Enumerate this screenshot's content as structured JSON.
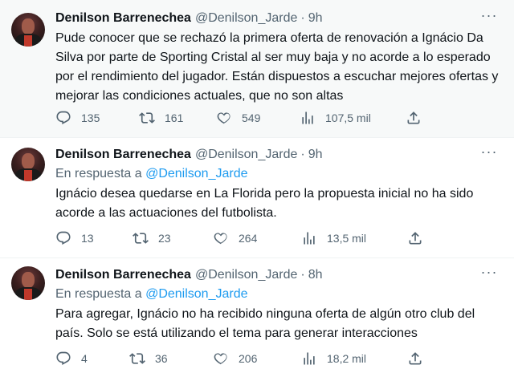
{
  "tweets": [
    {
      "name": "Denilson Barrenechea",
      "handle": "@Denilson_Jarde",
      "separator": "·",
      "time": "9h",
      "reply_prefix": "",
      "reply_handle": "",
      "text": "Pude conocer que se rechazó la primera oferta de renovación a Ignácio Da Silva por parte de Sporting Cristal al ser muy baja y no acorde a lo esperado por el rendimiento del jugador. Están dispuestos a escuchar mejores ofertas y mejorar las condiciones actuales, que no son  altas",
      "replies": "135",
      "retweets": "161",
      "likes": "549",
      "views": "107,5 mil"
    },
    {
      "name": "Denilson Barrenechea",
      "handle": "@Denilson_Jarde",
      "separator": "·",
      "time": "9h",
      "reply_prefix": "En respuesta a",
      "reply_handle": "@Denilson_Jarde",
      "text": "Ignácio desea quedarse en La Florida pero la propuesta inicial no ha sido acorde a las actuaciones del futbolista.",
      "replies": "13",
      "retweets": "23",
      "likes": "264",
      "views": "13,5 mil"
    },
    {
      "name": "Denilson Barrenechea",
      "handle": "@Denilson_Jarde",
      "separator": "·",
      "time": "8h",
      "reply_prefix": "En respuesta a",
      "reply_handle": "@Denilson_Jarde",
      "text": "Para agregar, Ignácio no ha recibido ninguna oferta de algún otro club del país. Solo se está utilizando el tema para generar interacciones",
      "replies": "4",
      "retweets": "36",
      "likes": "206",
      "views": "18,2 mil"
    }
  ],
  "icons": {
    "more": "more-icon",
    "reply": "reply-icon",
    "retweet": "retweet-icon",
    "like": "like-icon",
    "views": "views-icon",
    "share": "share-icon"
  },
  "colors": {
    "text": "#0f1419",
    "secondary": "#536471",
    "link": "#1d9bf0",
    "highlight_bg": "#f7f9f9"
  }
}
